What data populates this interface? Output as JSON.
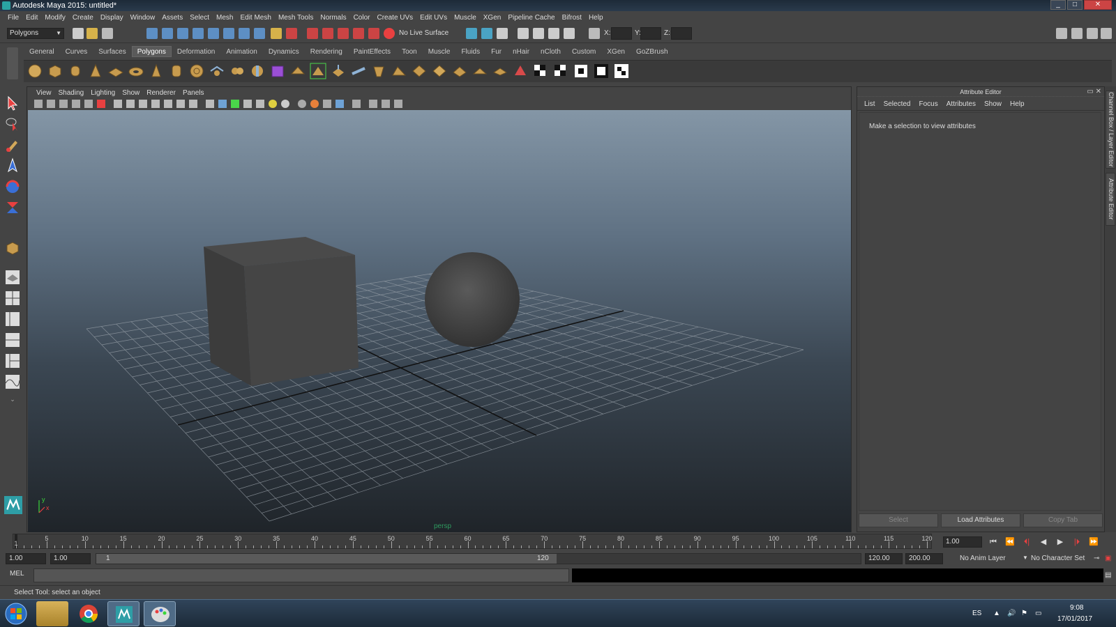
{
  "window": {
    "title": "Autodesk Maya 2015: untitled*",
    "buttons": [
      "_",
      "□",
      "✕"
    ]
  },
  "menubar": [
    "File",
    "Edit",
    "Modify",
    "Create",
    "Display",
    "Window",
    "Assets",
    "Select",
    "Mesh",
    "Edit Mesh",
    "Mesh Tools",
    "Normals",
    "Color",
    "Create UVs",
    "Edit UVs",
    "Muscle",
    "XGen",
    "Pipeline Cache",
    "Bifrost",
    "Help"
  ],
  "statusline": {
    "mode": "Polygons",
    "live_surface": "No Live Surface",
    "x_label": "X:",
    "y_label": "Y:",
    "z_label": "Z:"
  },
  "shelf": {
    "tabs": [
      "General",
      "Curves",
      "Surfaces",
      "Polygons",
      "Deformation",
      "Animation",
      "Dynamics",
      "Rendering",
      "PaintEffects",
      "Toon",
      "Muscle",
      "Fluids",
      "Fur",
      "nHair",
      "nCloth",
      "Custom",
      "XGen",
      "GoZBrush"
    ],
    "active_tab": "Polygons"
  },
  "viewport": {
    "menus": [
      "View",
      "Shading",
      "Lighting",
      "Show",
      "Renderer",
      "Panels"
    ],
    "camera_label": "persp",
    "axis_y": "y",
    "axis_x": "x"
  },
  "attribute_editor": {
    "title": "Attribute Editor",
    "menus": [
      "List",
      "Selected",
      "Focus",
      "Attributes",
      "Show",
      "Help"
    ],
    "message": "Make a selection to view attributes",
    "buttons": {
      "select": "Select",
      "load": "Load Attributes",
      "copy": "Copy Tab"
    },
    "side_tabs": [
      "Channel Box / Layer Editor",
      "Attribute Editor"
    ]
  },
  "timeslider": {
    "ticks": [
      "5",
      "10",
      "15",
      "20",
      "25",
      "30",
      "35",
      "40",
      "45",
      "50",
      "55",
      "60",
      "65",
      "70",
      "75",
      "80",
      "85",
      "90",
      "95",
      "100",
      "105",
      "110",
      "115",
      "120"
    ],
    "current_marker": "1",
    "current_frame": "1.00",
    "controls": [
      "⏮",
      "⏪",
      "⏴|",
      "◀",
      "▶",
      "|⏵",
      "⏩"
    ]
  },
  "rangeslider": {
    "start": "1.00",
    "playback_start": "1.00",
    "range_start_label": "1",
    "range_end_label": "120",
    "playback_end": "120.00",
    "end": "200.00",
    "anim_layer": "No Anim Layer",
    "character_set": "No Character Set"
  },
  "commandline": {
    "label": "MEL"
  },
  "helpline": {
    "text": "Select Tool: select an object"
  },
  "taskbar": {
    "lang": "ES",
    "time": "9:08",
    "date": "17/01/2017"
  },
  "colors": {
    "accent": "#5dbcd2",
    "bg": "#444444",
    "play_red": "#e84040"
  }
}
